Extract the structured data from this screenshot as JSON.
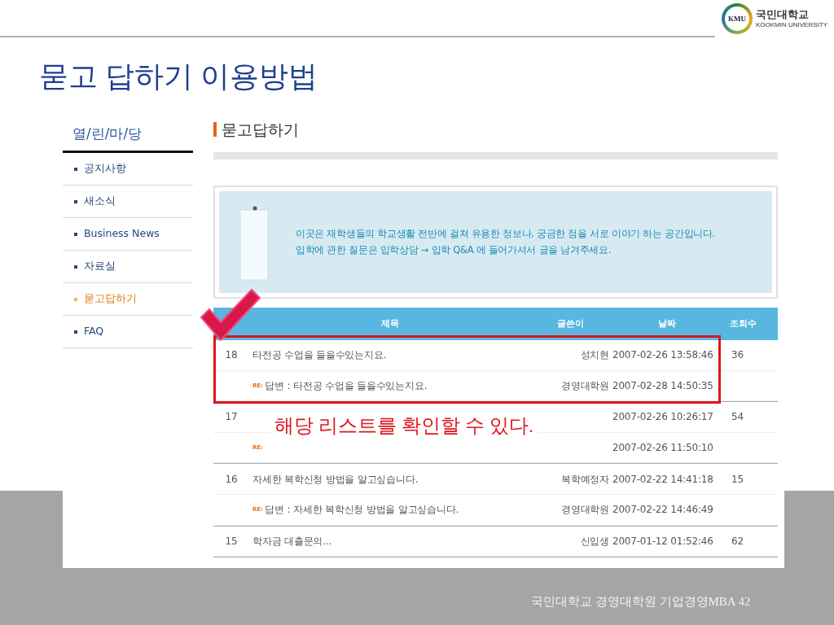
{
  "slide": {
    "logo": {
      "abbr": "KMU",
      "name": "국민대학교",
      "subtitle": "KOOKMIN UNIVERSITY"
    },
    "title": "묻고 답하기 이용방법",
    "callout": "해당 리스트를 확인할 수 있다.",
    "footer": "국민대학교 경영대학원 기업경영MBA 42"
  },
  "page": {
    "sidebar": {
      "heading": "열/린/마/당",
      "items": [
        {
          "label": "공지사항",
          "selected": false
        },
        {
          "label": "새소식",
          "selected": false
        },
        {
          "label": "Business News",
          "selected": false
        },
        {
          "label": "자료실",
          "selected": false
        },
        {
          "label": "묻고답하기",
          "selected": true
        },
        {
          "label": "FAQ",
          "selected": false
        }
      ]
    },
    "section_title": "묻고답하기",
    "notice": [
      "이곳은 재학생들의 학교생활 전반에 걸쳐 유용한 정보나, 궁금한 점을 서로 이야기 하는 공간입니다.",
      "입학에 관한 질문은 입학상담 → 입학 Q&A 에 들어가셔서 글을 남겨주세요."
    ],
    "table": {
      "columns": [
        "제목",
        "글쓴이",
        "날짜",
        "조회수"
      ],
      "threads": [
        {
          "highlighted": true,
          "rows": [
            {
              "kind": "post",
              "number": "18",
              "title": "타전공 수업을 들을수있는지요.",
              "author": "성치현",
              "date": "2007-02-26 13:58:46",
              "views": "36"
            },
            {
              "kind": "reply",
              "badge": "RE:",
              "title": "답변 : 타전공 수업을 들을수있는지요.",
              "author": "경영대학원",
              "date": "2007-02-28 14:50:35"
            }
          ]
        },
        {
          "highlighted": false,
          "rows": [
            {
              "kind": "post",
              "number": "17",
              "date": "2007-02-26 10:26:17",
              "views": "54"
            },
            {
              "kind": "reply",
              "badge": "RE:",
              "date": "2007-02-26 11:50:10"
            }
          ]
        },
        {
          "highlighted": false,
          "rows": [
            {
              "kind": "post",
              "number": "16",
              "title": "자세한 복학신청 방법을 알고싶습니다.",
              "author": "복학예정자",
              "date": "2007-02-22 14:41:18",
              "views": "15"
            },
            {
              "kind": "reply",
              "badge": "RE:",
              "title": "답변 : 자세한 복학신청 방법을 알고싶습니다.",
              "author": "경영대학원",
              "date": "2007-02-22 14:46:49"
            }
          ]
        },
        {
          "highlighted": false,
          "rows": [
            {
              "kind": "post",
              "number": "15",
              "title": "학자금 대출문의...",
              "author": "신입생",
              "date": "2007-01-12 01:52:46",
              "views": "62"
            }
          ]
        }
      ]
    }
  }
}
